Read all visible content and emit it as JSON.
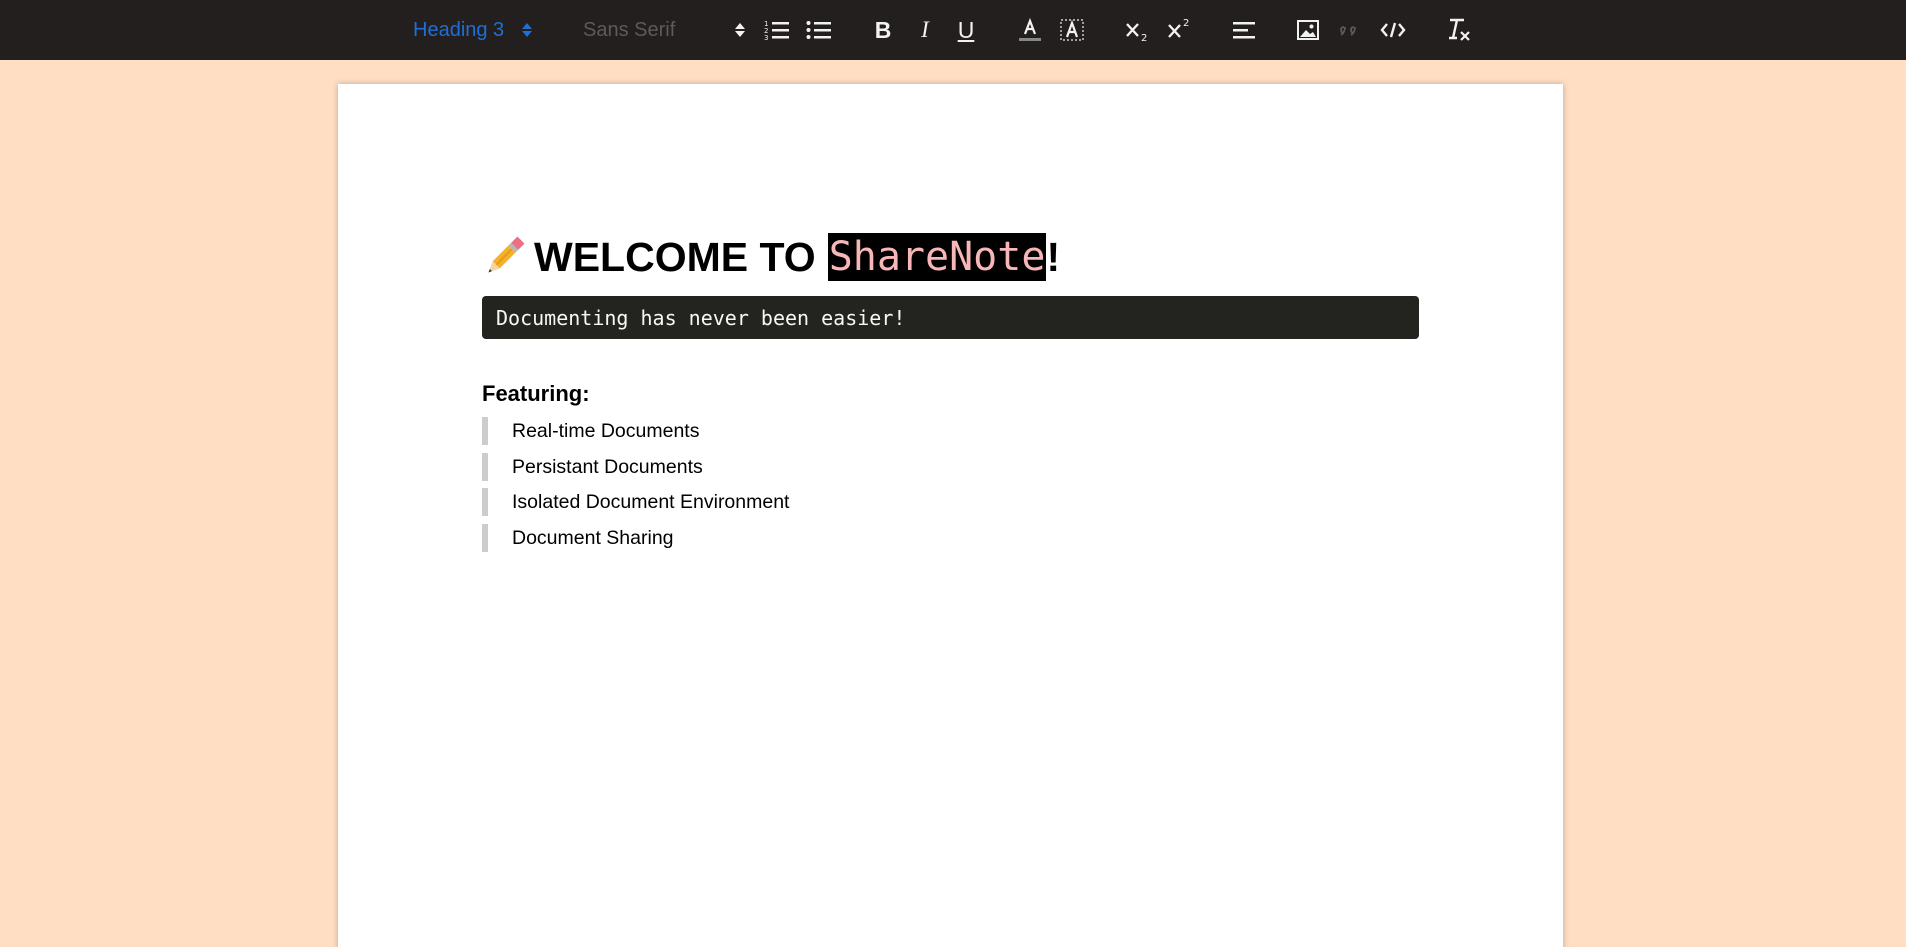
{
  "toolbar": {
    "heading_select": "Heading 3",
    "font_select": "Sans Serif",
    "buttons": [
      {
        "name": "ordered-list-icon"
      },
      {
        "name": "bullet-list-icon"
      },
      {
        "name": "bold-icon",
        "label": "B"
      },
      {
        "name": "italic-icon",
        "label": "I"
      },
      {
        "name": "underline-icon",
        "label": "U"
      },
      {
        "name": "text-color-icon"
      },
      {
        "name": "background-color-icon"
      },
      {
        "name": "subscript-icon"
      },
      {
        "name": "superscript-icon"
      },
      {
        "name": "align-icon"
      },
      {
        "name": "image-icon"
      },
      {
        "name": "blockquote-icon"
      },
      {
        "name": "code-icon"
      },
      {
        "name": "clear-format-icon"
      }
    ],
    "bold_label": "B",
    "italic_label": "I",
    "underline_label": "U",
    "colors": {
      "background": "#231f1e",
      "active": "#1e6fd8",
      "disabled": "#5d5a59"
    }
  },
  "document": {
    "title_prefix": "WELCOME TO",
    "title_brand": "ShareNote",
    "title_suffix": "!",
    "code_line": "Documenting has never been easier!",
    "features_heading": "Featuring:",
    "features": [
      "Real-time Documents",
      "Persistant Documents",
      "Isolated Document Environment",
      "Document Sharing"
    ]
  },
  "colors": {
    "page_background": "#ffdec4",
    "brand_text": "#f7b7b9"
  }
}
